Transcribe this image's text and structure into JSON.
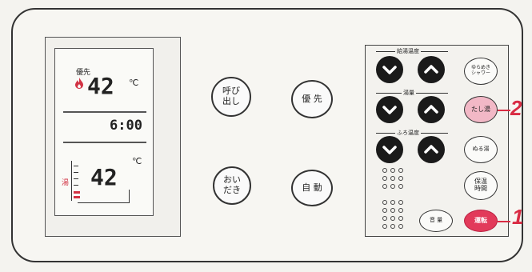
{
  "display": {
    "priority_label": "優先",
    "temp_top": "42",
    "temp_unit_top": "℃",
    "time": "6:00",
    "temp_bottom": "42",
    "temp_unit_bottom": "℃",
    "bath_label": "湯"
  },
  "center_buttons": {
    "call": "呼び\n出し",
    "priority": "優 先",
    "reheat": "おい\nだき",
    "auto": "自 動"
  },
  "right_panel": {
    "group_temp_label": "給湯温度",
    "group_volume_label": "湯量",
    "group_bath_temp_label": "ふろ温度",
    "gentle_shower": "ゆらめき\nシャワー",
    "add_hot_water": "たし湯",
    "lukewarm_water": "ぬる湯",
    "keep_warm_time": "保温\n時間",
    "volume": "音 量",
    "run": "運転"
  },
  "callouts": {
    "one": "1",
    "two": "2"
  },
  "colors": {
    "run_button": "#e23a5a",
    "add_hot_water_highlight": "#f2b8c6",
    "callout": "#d92b43",
    "display_accent": "#d23344"
  }
}
